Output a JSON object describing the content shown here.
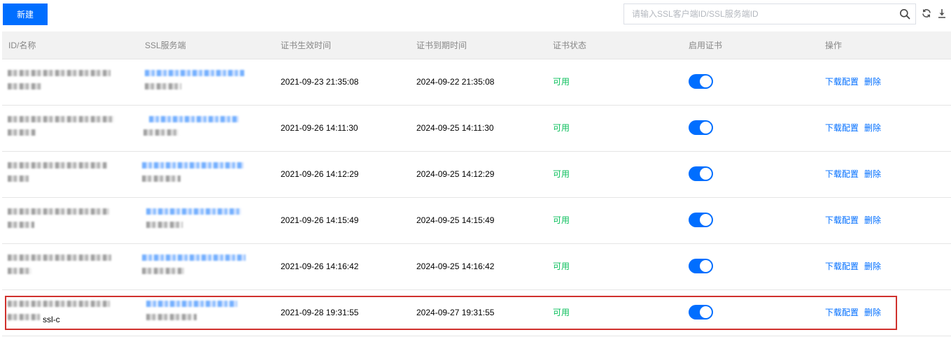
{
  "toolbar": {
    "new_button": "新建",
    "search_placeholder": "请输入SSL客户端ID/SSL服务端ID",
    "search_icon": "search-icon",
    "refresh_icon": "refresh-icon",
    "download_icon": "download-icon"
  },
  "table": {
    "columns": [
      "ID/名称",
      "SSL服务端",
      "证书生效时间",
      "证书到期时间",
      "证书状态",
      "启用证书",
      "操作"
    ],
    "rows": [
      {
        "start": "2021-09-23 21:35:08",
        "end": "2024-09-22 21:35:08",
        "status": "可用",
        "enabled": true,
        "download": "下载配置",
        "delete": "删除",
        "id_suffix": ""
      },
      {
        "start": "2021-09-26 14:11:30",
        "end": "2024-09-25 14:11:30",
        "status": "可用",
        "enabled": true,
        "download": "下载配置",
        "delete": "删除",
        "id_suffix": ""
      },
      {
        "start": "2021-09-26 14:12:29",
        "end": "2024-09-25 14:12:29",
        "status": "可用",
        "enabled": true,
        "download": "下载配置",
        "delete": "删除",
        "id_suffix": ""
      },
      {
        "start": "2021-09-26 14:15:49",
        "end": "2024-09-25 14:15:49",
        "status": "可用",
        "enabled": true,
        "download": "下载配置",
        "delete": "删除",
        "id_suffix": ""
      },
      {
        "start": "2021-09-26 14:16:42",
        "end": "2024-09-25 14:16:42",
        "status": "可用",
        "enabled": true,
        "download": "下载配置",
        "delete": "删除",
        "id_suffix": ""
      },
      {
        "start": "2021-09-28 19:31:55",
        "end": "2024-09-27 19:31:55",
        "status": "可用",
        "enabled": true,
        "download": "下载配置",
        "delete": "删除",
        "id_suffix": "ssl-c"
      }
    ]
  },
  "colors": {
    "primary": "#006eff",
    "status_ok": "#0abf5b",
    "highlight": "#d0312d"
  }
}
